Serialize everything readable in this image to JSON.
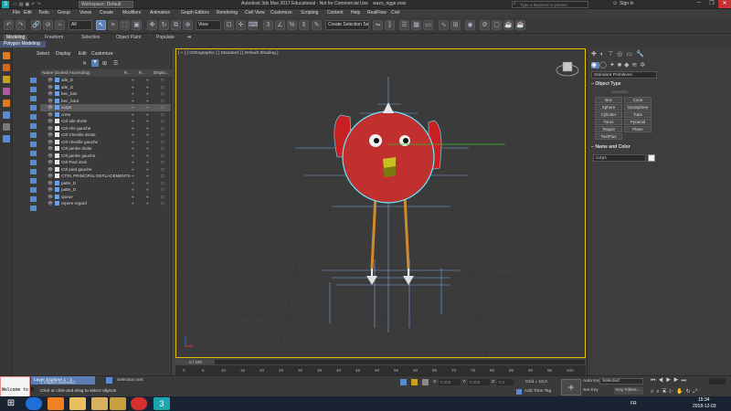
{
  "titlebar": {
    "workspace": "Workspace: Default",
    "title": "Autodesk 3ds Max 2017 Educational - Not for Commercial Use",
    "file": "wazo_rigge.max",
    "search_placeholder": "Type a keyword or phrase",
    "signin": "Sign In"
  },
  "menu": [
    "File",
    "Edit",
    "Tools",
    "Group",
    "Views",
    "Create",
    "Modifiers",
    "Animation",
    "Graph Editors",
    "Rendering",
    "Civil View",
    "Customize",
    "Scripting",
    "Content",
    "Help",
    "RealFlow",
    "Civil"
  ],
  "toolbar": {
    "filter_value": "All",
    "view_value": "View",
    "selection_set_value": "Create Selection Se"
  },
  "ribbon": {
    "tabs": [
      "Modeling",
      "Freeform",
      "Selection",
      "Object Paint",
      "Populate"
    ],
    "active_tab": "Modeling",
    "sub_label": "Polygon Modeling"
  },
  "explorer": {
    "menu": [
      "Select",
      "Display",
      "Edit",
      "Customize"
    ],
    "col_name": "Name (Sorted Ascending)",
    "col_r": "R...",
    "col_r2": "R...",
    "col_disp": "Displa...",
    "rows": [
      "aile_D",
      "aile_G",
      "bec_bas",
      "bec_haut",
      "corps",
      "crete",
      "Ctrl aile droite",
      "Ctrl Aile gauche",
      "Ctrl Cheville droite",
      "Ctrl cheville gauche",
      "Ctrl jambe droite",
      "Ctrl jambe gauche",
      "Ctrl Pied droit",
      "Ctrl pied gauche",
      "CTRL PRINCIPAL DEPLACEMENTS",
      "patte_D",
      "patte_G",
      "queue",
      "repere regard"
    ],
    "selected_row": "corps"
  },
  "viewport": {
    "label": "[ + ] [ Orthographic ] [ Standard ] [ Default Shading ]"
  },
  "cmdpanel": {
    "category": "Standard Primitives",
    "object_type_header": "Object Type",
    "autogrid": "AutoGrid",
    "primitives": [
      "Box",
      "Cone",
      "Sphere",
      "GeoSphere",
      "Cylinder",
      "Tube",
      "Torus",
      "Pyramid",
      "Teapot",
      "Plane",
      "TextPlus"
    ],
    "name_color_header": "Name and Color",
    "object_name": "corps"
  },
  "timeline": {
    "frame_counter": "0 / 100",
    "ticks": [
      "0",
      "5",
      "10",
      "15",
      "20",
      "25",
      "30",
      "35",
      "40",
      "45",
      "50",
      "55",
      "60",
      "65",
      "70",
      "75",
      "80",
      "85",
      "90",
      "95",
      "100"
    ]
  },
  "status": {
    "layer_explorer": "Layer Explorer 1 - 1",
    "selection_set_label": "Selection Set:",
    "objects_selected": "1 Object Selected",
    "prompt": "Click or click-and-drag to select objects",
    "welcome": "Welcome to M",
    "x_label": "X:",
    "x_value": "0,000",
    "y_label": "Y:",
    "y_value": "0,000",
    "z_label": "Z:",
    "z_value": "0,0",
    "grid": "Grid = 10,0",
    "add_time_tag": "Add Time Tag",
    "auto_key": "Auto Key",
    "set_key": "Set Key",
    "key_mode_value": "Selected",
    "key_filters": "Key Filters..."
  },
  "taskbar": {
    "lang": "FR",
    "time": "15:34",
    "date": "2018-12-03"
  },
  "colors": {
    "viewport_bg": "#3b3b3b",
    "selection_yellow": "#e0c000",
    "body_red": "#c0302f",
    "bone_orange": "#d08a2e",
    "select_cyan": "#66e8ff",
    "accent_blue": "#5b7fb5"
  }
}
